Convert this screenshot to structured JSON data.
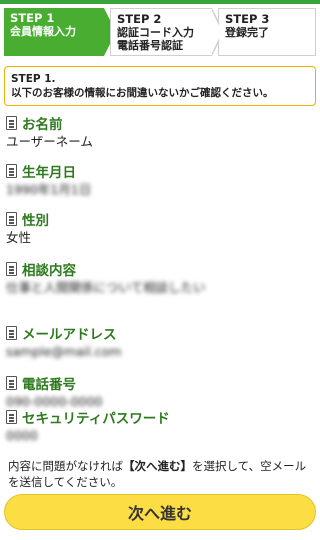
{
  "steps": [
    {
      "num": "STEP 1",
      "label": "会員情報入力"
    },
    {
      "num": "STEP 2",
      "label": "認証コード入力\n電話番号認証"
    },
    {
      "num": "STEP 3",
      "label": "登録完了"
    }
  ],
  "notice": {
    "title": "STEP 1.",
    "text": "以下のお客様の情報にお間違いないかご確認ください。"
  },
  "fields": [
    {
      "label": "お名前",
      "value": "ユーザーネーム"
    },
    {
      "label": "生年月日",
      "value": "1990年1月1日"
    },
    {
      "label": "性別",
      "value": "女性"
    },
    {
      "label": "相談内容",
      "value": "仕事と人間関係について相談したい"
    },
    {
      "label": "メールアドレス",
      "value": "sample@mail.com"
    },
    {
      "label": "電話番号",
      "value": "090-0000-0000"
    },
    {
      "label": "セキュリティパスワード",
      "value": "0000"
    }
  ],
  "instruction": {
    "pre": "内容に問題がなければ",
    "emphasis": "【次へ進む】",
    "post": "を選択して、空メールを送信してください。"
  },
  "next_button": {
    "label": "次へ進む"
  },
  "colors": {
    "accent": "#49ad32",
    "label_green": "#2e7a1f",
    "notice_border": "#f0b400",
    "button": "#fddd44"
  }
}
